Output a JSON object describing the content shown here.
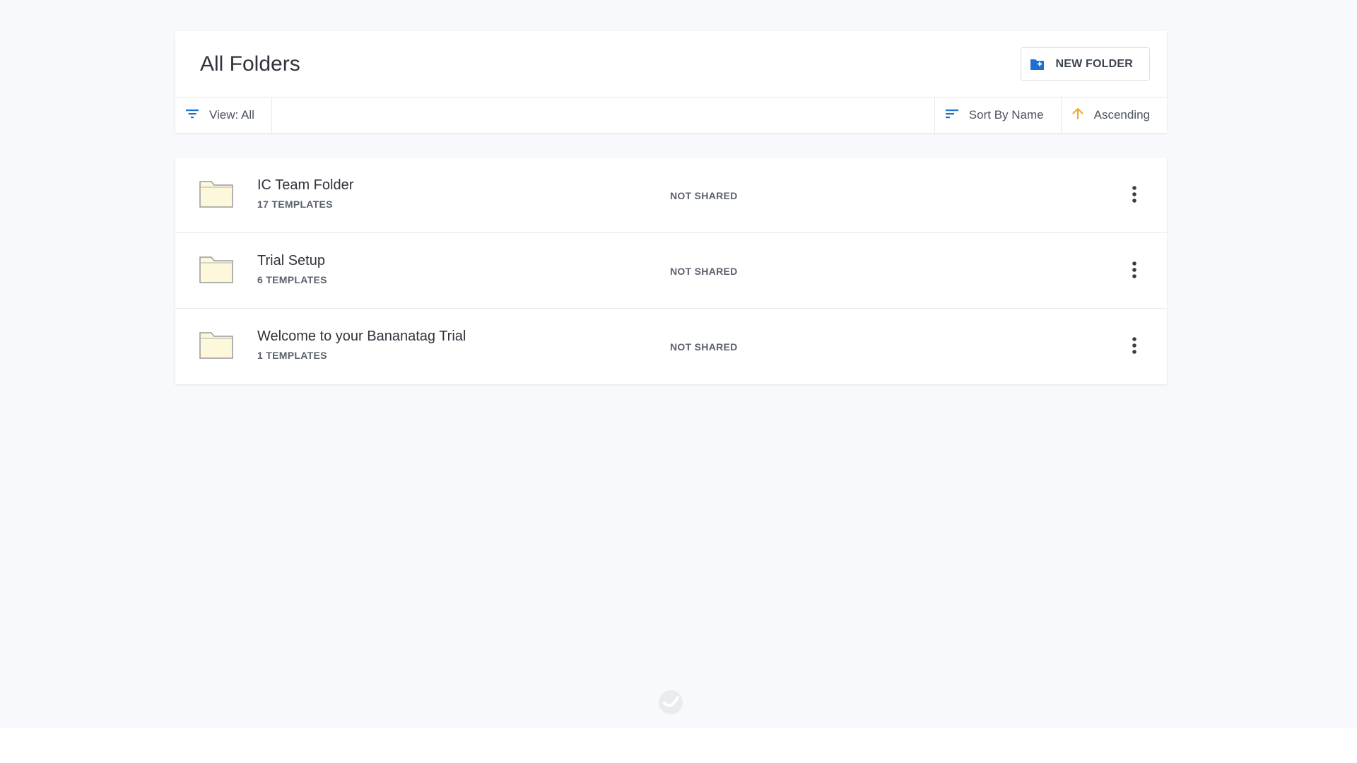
{
  "header": {
    "title": "All Folders",
    "new_folder_label": "NEW FOLDER"
  },
  "toolbar": {
    "view_label": "View: All",
    "sort_label": "Sort By Name",
    "order_label": "Ascending"
  },
  "folders": [
    {
      "name": "IC Team Folder",
      "count": "17 TEMPLATES",
      "status": "NOT SHARED"
    },
    {
      "name": "Trial Setup",
      "count": "6 TEMPLATES",
      "status": "NOT SHARED"
    },
    {
      "name": "Welcome to your Bananatag Trial",
      "count": "1 TEMPLATES",
      "status": "NOT SHARED"
    }
  ],
  "icons": {
    "new_folder": "folder-plus-icon",
    "filter": "filter-icon",
    "sort": "sort-icon",
    "order": "arrow-up-icon",
    "folder": "folder-icon",
    "more": "more-vertical-icon",
    "loader": "bananatag-logo-icon"
  },
  "colors": {
    "accent_blue": "#1f6fd1",
    "arrow_orange": "#f2a52b",
    "folder_fill": "#fdf8dc",
    "background": "#f8f9fc"
  }
}
